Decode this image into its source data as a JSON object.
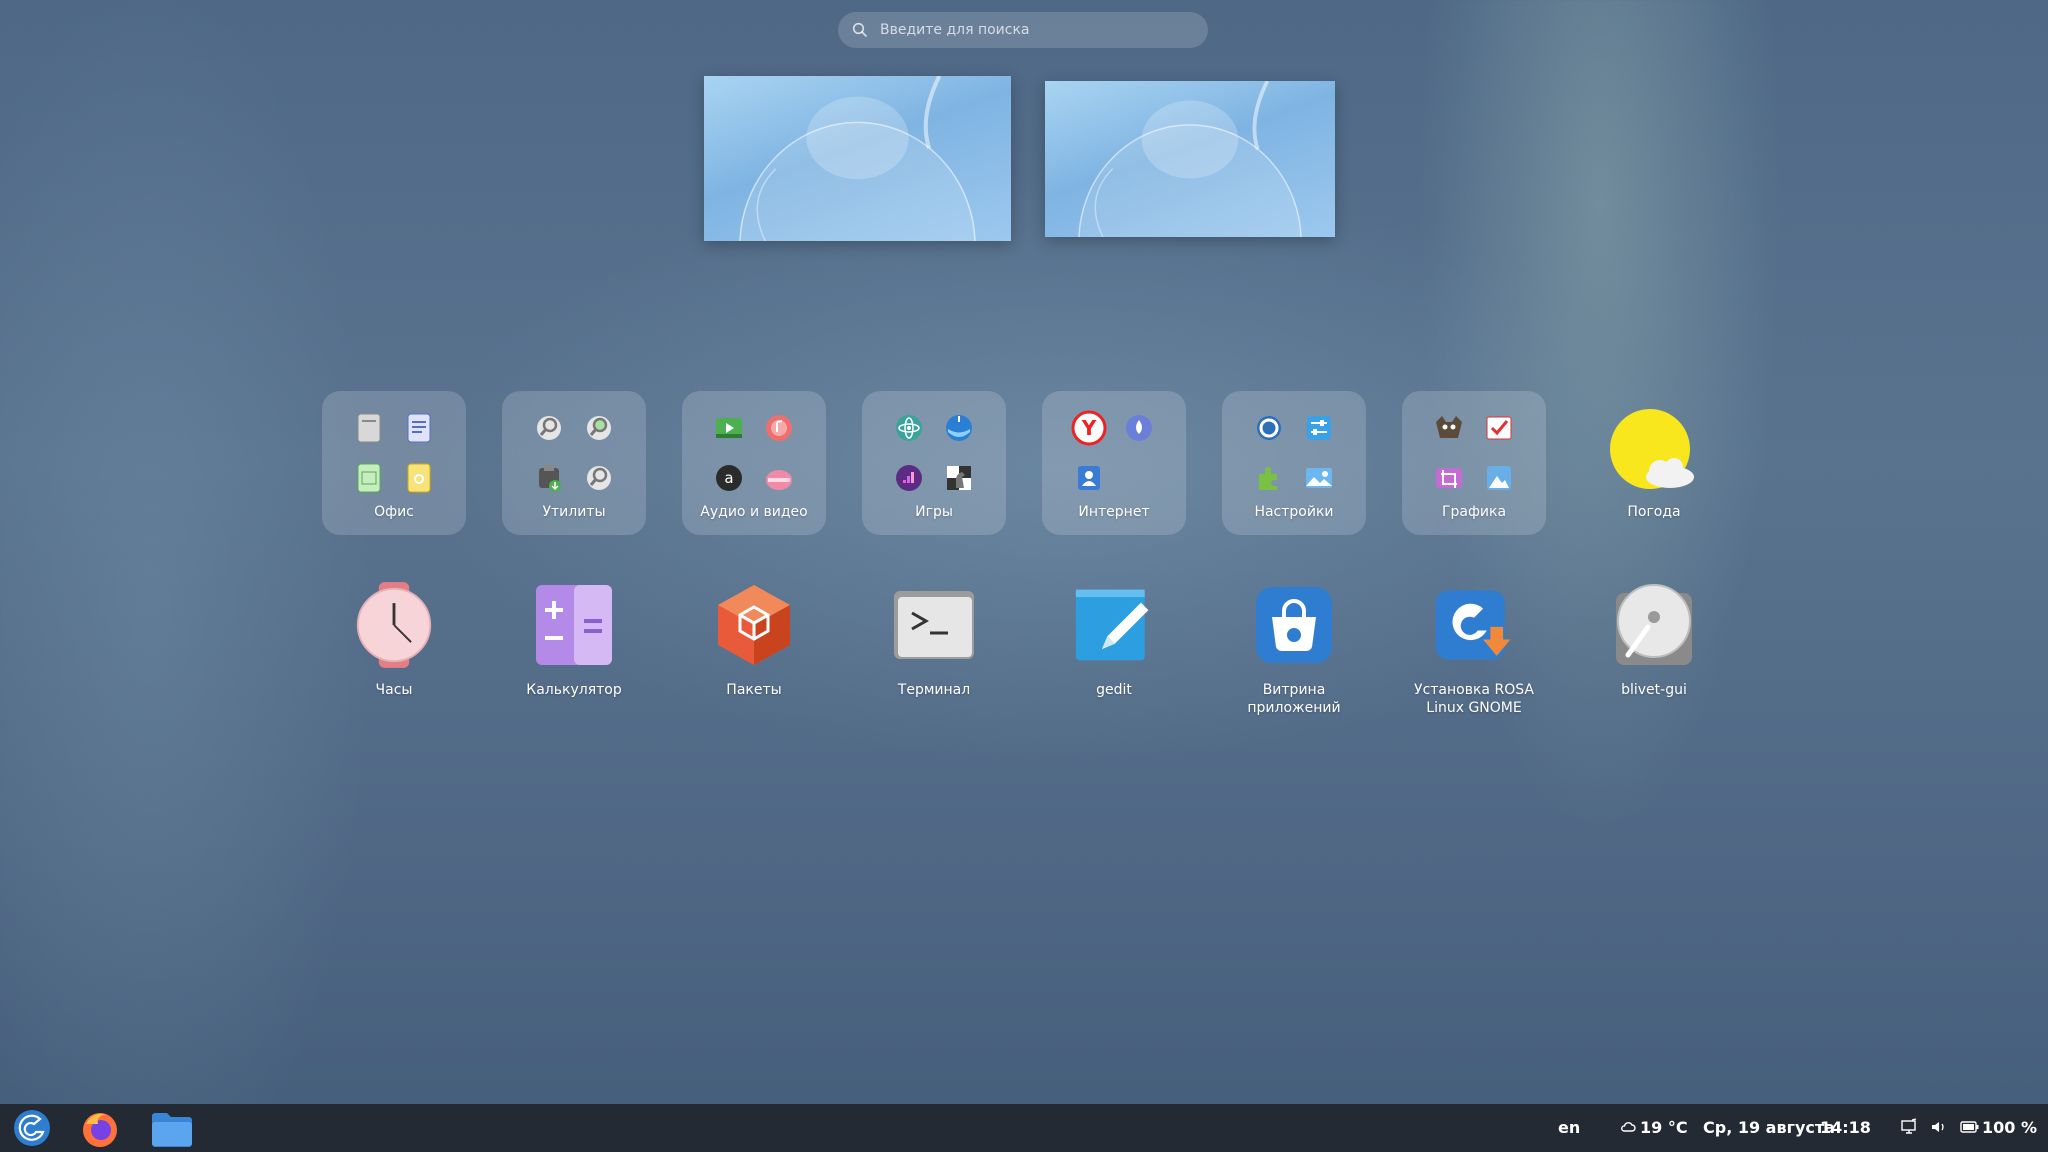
{
  "search": {
    "placeholder": "Введите для поиска"
  },
  "folders": [
    {
      "label": "Офис"
    },
    {
      "label": "Утилиты"
    },
    {
      "label": "Аудио и видео"
    },
    {
      "label": "Игры"
    },
    {
      "label": "Интернет"
    },
    {
      "label": "Настройки"
    },
    {
      "label": "Графика"
    }
  ],
  "apps_row1": [
    {
      "label": "Погода"
    }
  ],
  "apps_row2": [
    {
      "label": "Часы"
    },
    {
      "label": "Калькулятор"
    },
    {
      "label": "Пакеты"
    },
    {
      "label": "Терминал"
    },
    {
      "label": "gedit"
    },
    {
      "label": "Витрина\nприложений"
    },
    {
      "label": "Установка ROSA\nLinux GNOME"
    },
    {
      "label": "blivet-gui"
    }
  ],
  "taskbar": {
    "language": "en",
    "temperature": "19 °C",
    "date": "Ср, 19 августа",
    "time": "14:18",
    "battery": "100 %"
  },
  "colors": {
    "taskbar_bg": "#232a33",
    "accent": "#2f7dd1"
  }
}
